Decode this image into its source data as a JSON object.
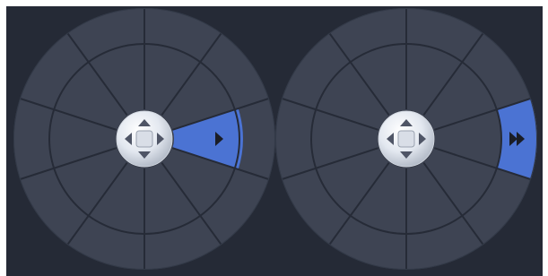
{
  "controls": [
    {
      "name": "pan-wheel-slow",
      "selected_direction": "right",
      "highlight_icon": "play-single-icon",
      "center_icon": "four-way-arrows-icon",
      "segments": [
        "right",
        "lower-right",
        "down-right",
        "down",
        "down-left",
        "lower-left",
        "left",
        "upper-left",
        "up-left",
        "up",
        "up-right",
        "upper-right"
      ]
    },
    {
      "name": "pan-wheel-fast",
      "selected_direction": "right",
      "highlight_icon": "fast-forward-icon",
      "center_icon": "four-way-arrows-icon",
      "segments": [
        "right",
        "lower-right",
        "down-right",
        "down",
        "down-left",
        "lower-left",
        "left",
        "upper-left",
        "up-left",
        "up",
        "up-right",
        "upper-right"
      ]
    }
  ],
  "colors": {
    "background": "#252a36",
    "wheel_fill": "#3e4453",
    "wheel_line": "#262b37",
    "highlight": "#4b73d3",
    "knob_light": "#f4f7fb",
    "knob_dark": "#aeb6c3",
    "arrow": "#1a1d26",
    "knob_arrow": "#4f5566"
  }
}
